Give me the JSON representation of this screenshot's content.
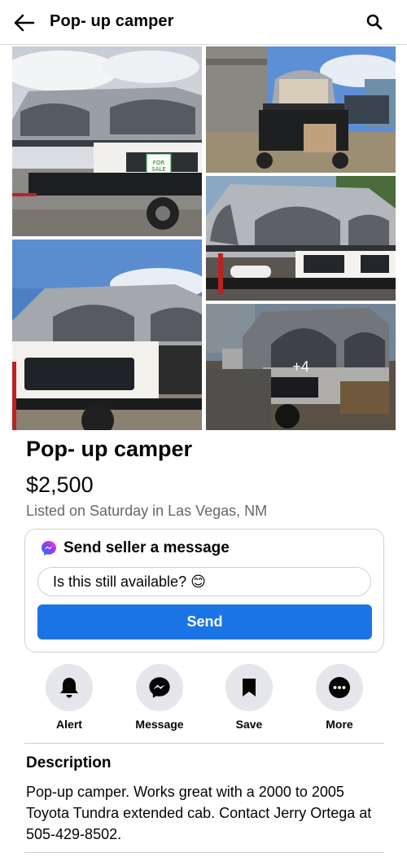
{
  "header": {
    "title": "Pop- up camper",
    "back_icon": "arrow-left-icon",
    "search_icon": "search-icon"
  },
  "photos": {
    "count": 5,
    "more_count_label": "+4",
    "sign_text": "FOR SALE"
  },
  "listing": {
    "title": "Pop- up camper",
    "price": "$2,500",
    "listed": "Listed on Saturday in Las Vegas, NM"
  },
  "message_card": {
    "title": "Send seller a message",
    "icon": "messenger-icon",
    "input_value": "Is this still available? 😊",
    "send_label": "Send"
  },
  "actions": [
    {
      "label": "Alert",
      "icon": "bell-icon"
    },
    {
      "label": "Message",
      "icon": "messenger-icon"
    },
    {
      "label": "Save",
      "icon": "bookmark-icon"
    },
    {
      "label": "More",
      "icon": "more-dots-icon"
    }
  ],
  "description": {
    "heading": "Description",
    "body": "Pop-up camper. Works great with a 2000 to 2005 Toyota Tundra extended cab. Contact Jerry Ortega at 505-429-8502."
  },
  "colors": {
    "accent": "#1b74e4",
    "muted_text": "#65676b",
    "action_bg": "#e4e6eb",
    "border": "#ced0d4"
  }
}
